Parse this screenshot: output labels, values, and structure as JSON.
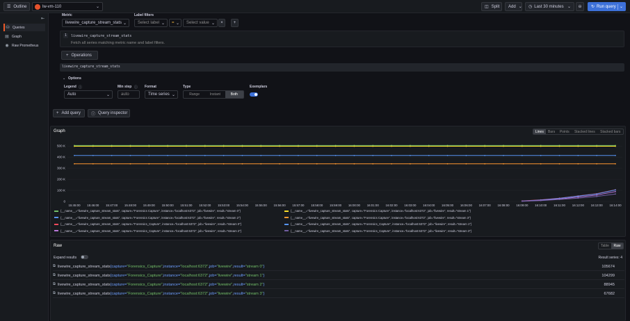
{
  "topbar": {
    "outline_label": "Outline",
    "datasource": "lw-vm-110",
    "split_label": "Split",
    "add_label": "Add",
    "time_range": "Last 30 minutes",
    "run_query_label": "Run query"
  },
  "sidebar": {
    "items": [
      {
        "label": "Queries",
        "icon": "database-icon"
      },
      {
        "label": "Graph",
        "icon": "graph-icon"
      },
      {
        "label": "Raw Prometheus",
        "icon": "prometheus-icon"
      }
    ]
  },
  "query": {
    "metric_label": "Metric",
    "metric_value": "livewire_capture_stream_stats",
    "label_filters_label": "Label filters",
    "select_label_placeholder": "Select label",
    "operator": "=",
    "select_value_placeholder": "Select value",
    "hint_step": "1",
    "hint_title": "livewire_capture_stream_stats",
    "hint_text": "Fetch all series matching metric name and label filters.",
    "operations_label": "Operations",
    "raw_query": "livewire_capture_stream_stats",
    "options_label": "Options",
    "legend_label": "Legend",
    "legend_value": "Auto",
    "min_step_label": "Min step",
    "min_step_placeholder": "auto",
    "format_label": "Format",
    "format_value": "Time series",
    "type_label": "Type",
    "type_options": [
      "Range",
      "Instant",
      "Both"
    ],
    "type_selected": "Both",
    "exemplars_label": "Exemplars",
    "exemplars_on": true
  },
  "actions": {
    "add_query_label": "Add query",
    "query_inspector_label": "Query inspector"
  },
  "graph": {
    "title": "Graph",
    "view_modes": [
      "Lines",
      "Bars",
      "Points",
      "Stacked lines",
      "Stacked bars"
    ],
    "view_selected": "Lines",
    "legend": [
      {
        "text": "{__name__=\"livewire_capture_stream_stats\", capture=\"Forensics Capture\", instance=\"localhost:6372\", job=\"livewire\", result=\"stream 0\"}",
        "color": "#73bf69"
      },
      {
        "text": "{__name__=\"livewire_capture_stream_stats\", capture=\"Forensics Capture\", instance=\"localhost:6372\", job=\"livewire\", result=\"stream 1\"}",
        "color": "#fade2a"
      },
      {
        "text": "{__name__=\"livewire_capture_stream_stats\", capture=\"Forensics Capture\", instance=\"localhost:6372\", job=\"livewire\", result=\"stream 2\"}",
        "color": "#5794f2"
      },
      {
        "text": "{__name__=\"livewire_capture_stream_stats\", capture=\"Forensics Capture\", instance=\"localhost:6372\", job=\"livewire\", result=\"stream 3\"}",
        "color": "#ff9830"
      },
      {
        "text": "{__name__=\"livewire_capture_stream_stats\", capture=\"Forensics_Capture\", instance=\"localhost:6372\", job=\"livewire\", result=\"stream 0\"}",
        "color": "#f2495c"
      },
      {
        "text": "{__name__=\"livewire_capture_stream_stats\", capture=\"Forensics_Capture\", instance=\"localhost:6372\", job=\"livewire\", result=\"stream 1\"}",
        "color": "#5794f2"
      },
      {
        "text": "{__name__=\"livewire_capture_stream_stats\", capture=\"Forensics_Capture\", instance=\"localhost:6372\", job=\"livewire\", result=\"stream 2\"}",
        "color": "#b877d9"
      },
      {
        "text": "{__name__=\"livewire_capture_stream_stats\", capture=\"Forensics_Capture\", instance=\"localhost:6372\", job=\"livewire\", result=\"stream 3\"}",
        "color": "#705da0"
      }
    ]
  },
  "chart_data": {
    "type": "line",
    "y_ticks": [
      "0",
      "100 K",
      "200 K",
      "300 K",
      "400 K",
      "500 K"
    ],
    "ylim": [
      0,
      520000
    ],
    "x_ticks": [
      "15:45:00",
      "15:46:00",
      "15:47:00",
      "15:48:00",
      "15:49:00",
      "15:50:00",
      "15:51:00",
      "15:52:00",
      "15:53:00",
      "15:54:00",
      "15:55:00",
      "15:56:00",
      "15:57:00",
      "15:58:00",
      "15:59:00",
      "16:00:00",
      "16:01:00",
      "16:02:00",
      "16:03:00",
      "16:04:00",
      "16:05:00",
      "16:06:00",
      "16:07:00",
      "16:08:00",
      "16:09:00",
      "16:10:00",
      "16:11:00",
      "16:12:00",
      "16:13:00",
      "16:14:00"
    ],
    "series": [
      {
        "color": "#73bf69",
        "values": [
          505000,
          505000,
          505000,
          505000,
          505000,
          505000,
          505000,
          505000,
          505000,
          505000,
          505000,
          505000,
          505000,
          505000,
          505000,
          505000,
          505000,
          505000,
          505000,
          505000,
          505000,
          505000,
          505000,
          505000,
          505000,
          505000,
          505000,
          505000,
          505000,
          505000
        ]
      },
      {
        "color": "#fade2a",
        "values": [
          498000,
          498000,
          498000,
          498000,
          498000,
          498000,
          498000,
          498000,
          498000,
          498000,
          498000,
          498000,
          498000,
          498000,
          498000,
          498000,
          498000,
          498000,
          498000,
          498000,
          498000,
          498000,
          498000,
          498000,
          498000,
          498000,
          498000,
          498000,
          498000,
          498000
        ]
      },
      {
        "color": "#5794f2",
        "values": [
          415000,
          415000,
          415000,
          415000,
          415000,
          415000,
          415000,
          415000,
          415000,
          415000,
          415000,
          415000,
          415000,
          415000,
          415000,
          415000,
          415000,
          415000,
          415000,
          415000,
          415000,
          415000,
          415000,
          415000,
          415000,
          415000,
          415000,
          415000,
          415000,
          415000
        ]
      },
      {
        "color": "#ff9830",
        "values": [
          340000,
          340000,
          340000,
          340000,
          340000,
          340000,
          340000,
          340000,
          340000,
          340000,
          340000,
          340000,
          340000,
          340000,
          340000,
          340000,
          340000,
          340000,
          340000,
          340000,
          340000,
          340000,
          340000,
          340000,
          340000,
          340000,
          340000,
          340000,
          340000,
          340000
        ]
      },
      {
        "color": "#f2495c",
        "values": [
          null,
          null,
          null,
          null,
          null,
          null,
          null,
          null,
          null,
          null,
          null,
          null,
          null,
          null,
          null,
          null,
          null,
          null,
          null,
          null,
          null,
          null,
          null,
          null,
          5000,
          15000,
          30000,
          50000,
          70000,
          105674
        ]
      },
      {
        "color": "#5794f2",
        "values": [
          null,
          null,
          null,
          null,
          null,
          null,
          null,
          null,
          null,
          null,
          null,
          null,
          null,
          null,
          null,
          null,
          null,
          null,
          null,
          null,
          null,
          null,
          null,
          null,
          4000,
          13000,
          28000,
          48000,
          68000,
          104299
        ]
      },
      {
        "color": "#b877d9",
        "values": [
          null,
          null,
          null,
          null,
          null,
          null,
          null,
          null,
          null,
          null,
          null,
          null,
          null,
          null,
          null,
          null,
          null,
          null,
          null,
          null,
          null,
          null,
          null,
          null,
          3000,
          10000,
          22000,
          40000,
          58000,
          88945
        ]
      },
      {
        "color": "#705da0",
        "values": [
          null,
          null,
          null,
          null,
          null,
          null,
          null,
          null,
          null,
          null,
          null,
          null,
          null,
          null,
          null,
          null,
          null,
          null,
          null,
          null,
          null,
          null,
          null,
          null,
          2000,
          8000,
          18000,
          30000,
          45000,
          67682
        ]
      }
    ]
  },
  "raw": {
    "title": "Raw",
    "view_options": [
      "Table",
      "Raw"
    ],
    "view_selected": "Raw",
    "expand_label": "Expand results",
    "result_series_label": "Result series: 4",
    "rows": [
      {
        "metric": "livewire_capture_stream_stats",
        "capture": "Forensics_Capture",
        "instance": "localhost:6372",
        "job": "livewire",
        "result": "stream 0",
        "value": "105674"
      },
      {
        "metric": "livewire_capture_stream_stats",
        "capture": "Forensics_Capture",
        "instance": "localhost:6372",
        "job": "livewire",
        "result": "stream 1",
        "value": "104299"
      },
      {
        "metric": "livewire_capture_stream_stats",
        "capture": "Forensics_Capture",
        "instance": "localhost:6372",
        "job": "livewire",
        "result": "stream 2",
        "value": "88945"
      },
      {
        "metric": "livewire_capture_stream_stats",
        "capture": "Forensics_Capture",
        "instance": "localhost:6372",
        "job": "livewire",
        "result": "stream 3",
        "value": "67682"
      }
    ]
  },
  "colors": {
    "run_button": "#3d71d9",
    "accent_orange": "#f05a28",
    "label_value_green": "#73bf69",
    "label_key_blue": "#6e9fff"
  }
}
